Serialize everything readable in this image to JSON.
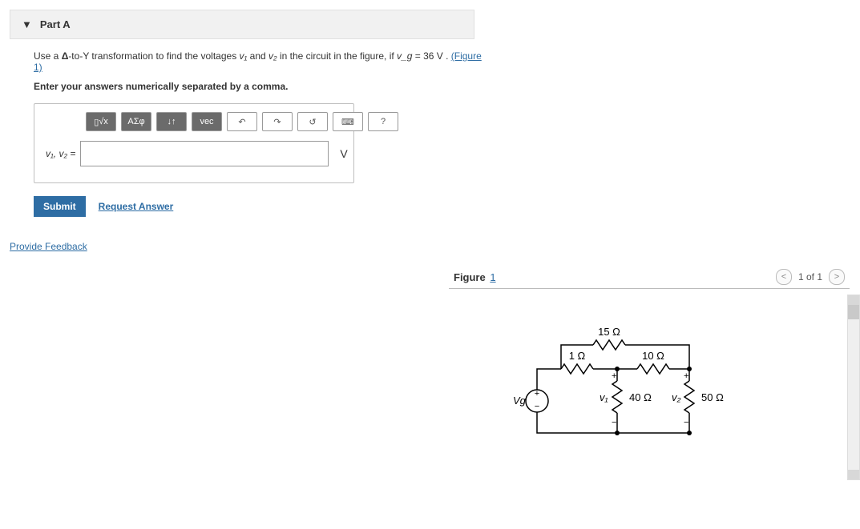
{
  "part": {
    "label": "Part A"
  },
  "question": {
    "prefix": "Use a ",
    "delta": "Δ",
    "mid1": "-to-Y transformation to find the voltages ",
    "v1": "v₁",
    "mid2": " and ",
    "v2": "v₂",
    "mid3": " in the circuit in the figure, if ",
    "vg": "v_g",
    "eq": " = 36 V . ",
    "figlink": "(Figure 1)"
  },
  "instruction": "Enter your answers numerically separated by a comma.",
  "toolbar": {
    "sqrt": "√x",
    "greek": "ΑΣφ",
    "subsup": "↓↑",
    "vec": "vec",
    "undo": "↶",
    "redo": "↷",
    "reset": "↺",
    "keyboard": "⌨",
    "help": "?"
  },
  "answer": {
    "label": "v₁, v₂ =",
    "value": "",
    "unit": "V"
  },
  "actions": {
    "submit": "Submit",
    "request": "Request Answer"
  },
  "feedback": "Provide Feedback",
  "figure": {
    "title": "Figure",
    "num": "1",
    "pager": "1 of 1",
    "r_top": "15 Ω",
    "r_left": "1 Ω",
    "r_right": "10 Ω",
    "r_mid": "40 Ω",
    "r_out": "50 Ω",
    "src": "Vg",
    "vlabel1": "v₁",
    "vlabel2": "v₂",
    "plus": "+",
    "minus": "−"
  }
}
